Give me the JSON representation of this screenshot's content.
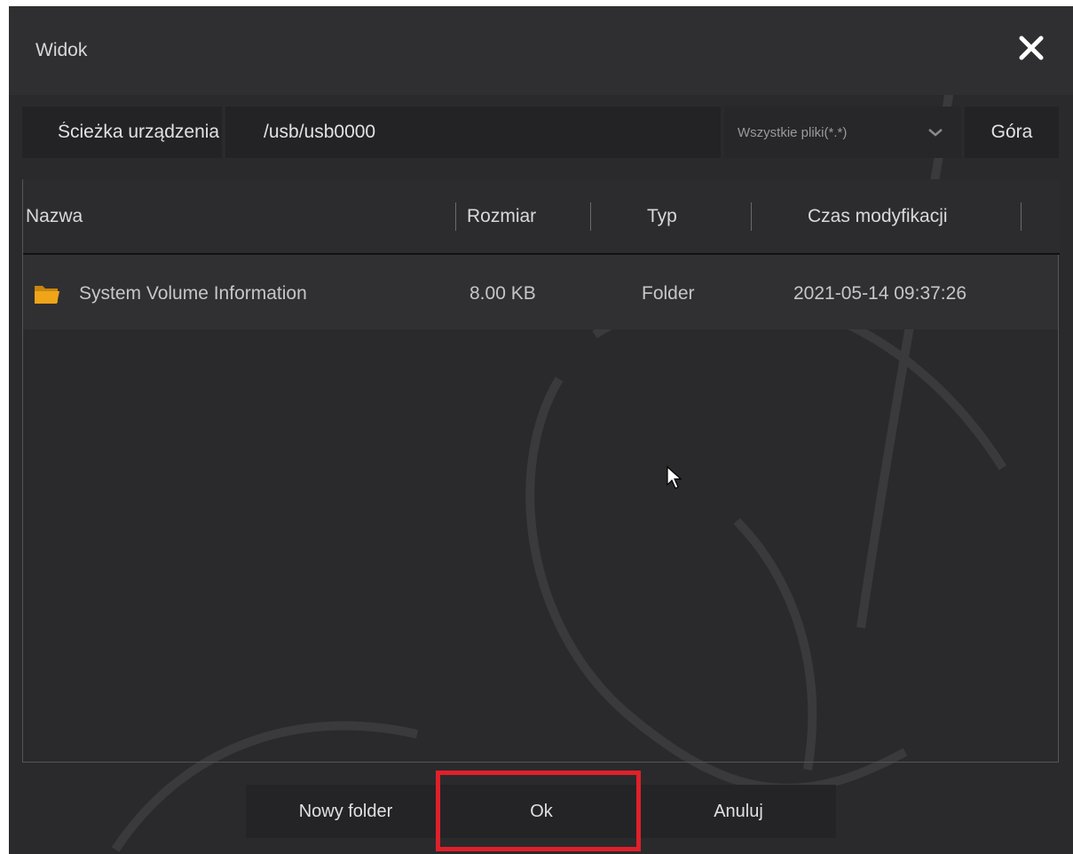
{
  "dialog": {
    "title": "Widok",
    "close_icon": "close-icon"
  },
  "path_bar": {
    "label": "Ścieżka urządzenia",
    "value": "/usb/usb0000",
    "filter": {
      "selected": "Wszystkie pliki(*.*)",
      "icon": "chevron-down-icon"
    },
    "up_label": "Góra"
  },
  "table": {
    "columns": [
      "Nazwa",
      "Rozmiar",
      "Typ",
      "Czas modyfikacji"
    ],
    "rows": [
      {
        "icon": "folder-icon",
        "name": "System Volume Information",
        "size": "8.00 KB",
        "type": "Folder",
        "modified": "2021-05-14 09:37:26"
      }
    ]
  },
  "buttons": {
    "new_folder": "Nowy folder",
    "ok": "Ok",
    "cancel": "Anuluj"
  },
  "colors": {
    "background": "#2a2a2c",
    "folder": "#f0a418",
    "highlight": "#e0202a"
  }
}
